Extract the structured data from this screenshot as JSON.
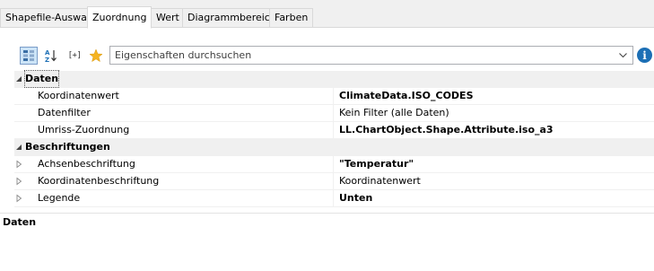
{
  "tabs": [
    {
      "label": "Shapefile-Auswahl",
      "active": false
    },
    {
      "label": "Zuordnung",
      "active": true
    },
    {
      "label": "Wert",
      "active": false
    },
    {
      "label": "Diagrammbereich",
      "active": false
    },
    {
      "label": "Farben",
      "active": false
    }
  ],
  "toolbar": {
    "search_placeholder": "Eigenschaften durchsuchen",
    "expand_label": "[+]",
    "info_label": "i"
  },
  "grid": {
    "categories": [
      {
        "label": "Daten",
        "expanded": true,
        "rows": [
          {
            "name": "Koordinatenwert",
            "value": "ClimateData.ISO_CODES",
            "bold": true
          },
          {
            "name": "Datenfilter",
            "value": "Kein Filter (alle Daten)",
            "bold": false
          },
          {
            "name": "Umriss-Zuordnung",
            "value": "LL.ChartObject.Shape.Attribute.iso_a3",
            "bold": true
          }
        ]
      },
      {
        "label": "Beschriftungen",
        "expanded": true,
        "rows": [
          {
            "name": "Achsenbeschriftung",
            "value": "\"Temperatur\"",
            "bold": true,
            "expandable": true
          },
          {
            "name": "Koordinatenbeschriftung",
            "value": "Koordinatenwert",
            "bold": false,
            "expandable": true
          },
          {
            "name": "Legende",
            "value": "Unten",
            "bold": true,
            "expandable": true
          }
        ]
      }
    ]
  },
  "description": {
    "title": "Daten"
  },
  "colors": {
    "accent": "#1c6fb5",
    "selected_button": "#cce4f7",
    "star": "#f5b320"
  }
}
